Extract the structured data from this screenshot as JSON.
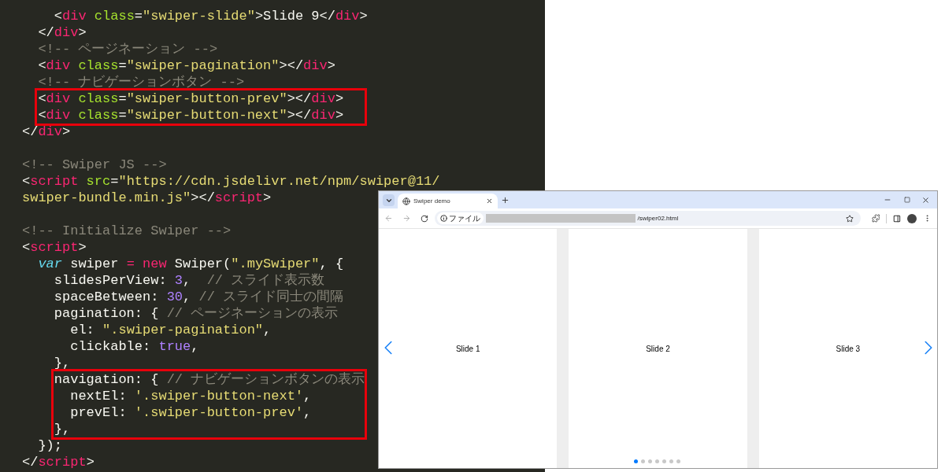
{
  "editor": {
    "blocks": [
      {
        "highlighted": false,
        "lines": [
          {
            "kind": "code",
            "tokens": [
              {
                "text": "    <",
                "kind": "punct"
              },
              {
                "text": "div",
                "kind": "tag"
              },
              {
                "text": " class",
                "kind": "attr"
              },
              {
                "text": "=",
                "kind": "punct"
              },
              {
                "text": "\"swiper-slide\"",
                "kind": "string"
              },
              {
                "text": ">Slide 9</",
                "kind": "punct"
              },
              {
                "text": "div",
                "kind": "tag"
              },
              {
                "text": ">",
                "kind": "punct"
              }
            ]
          },
          {
            "kind": "code",
            "tokens": [
              {
                "text": "  </",
                "kind": "punct"
              },
              {
                "text": "div",
                "kind": "tag"
              },
              {
                "text": ">",
                "kind": "punct"
              }
            ]
          },
          {
            "kind": "code",
            "tokens": [
              {
                "text": "  <!-- ページネーション -->",
                "kind": "comment"
              }
            ]
          },
          {
            "kind": "code",
            "tokens": [
              {
                "text": "  <",
                "kind": "punct"
              },
              {
                "text": "div",
                "kind": "tag"
              },
              {
                "text": " class",
                "kind": "attr"
              },
              {
                "text": "=",
                "kind": "punct"
              },
              {
                "text": "\"swiper-pagination\"",
                "kind": "string"
              },
              {
                "text": "></",
                "kind": "punct"
              },
              {
                "text": "div",
                "kind": "tag"
              },
              {
                "text": ">",
                "kind": "punct"
              }
            ]
          },
          {
            "kind": "code",
            "tokens": [
              {
                "text": "  <!-- ナビゲーションボタン -->",
                "kind": "comment"
              }
            ]
          }
        ]
      },
      {
        "highlighted": true,
        "lines": [
          {
            "kind": "code",
            "tokens": [
              {
                "text": "  <",
                "kind": "punct"
              },
              {
                "text": "div",
                "kind": "tag"
              },
              {
                "text": " class",
                "kind": "attr"
              },
              {
                "text": "=",
                "kind": "punct"
              },
              {
                "text": "\"swiper-button-prev\"",
                "kind": "string"
              },
              {
                "text": "></",
                "kind": "punct"
              },
              {
                "text": "div",
                "kind": "tag"
              },
              {
                "text": ">",
                "kind": "punct"
              }
            ]
          },
          {
            "kind": "code",
            "tokens": [
              {
                "text": "  <",
                "kind": "punct"
              },
              {
                "text": "div",
                "kind": "tag"
              },
              {
                "text": " class",
                "kind": "attr"
              },
              {
                "text": "=",
                "kind": "punct"
              },
              {
                "text": "\"swiper-button-next\"",
                "kind": "string"
              },
              {
                "text": "></",
                "kind": "punct"
              },
              {
                "text": "div",
                "kind": "tag"
              },
              {
                "text": ">",
                "kind": "punct"
              }
            ]
          }
        ]
      },
      {
        "highlighted": false,
        "lines": [
          {
            "kind": "code",
            "tokens": [
              {
                "text": "</",
                "kind": "punct"
              },
              {
                "text": "div",
                "kind": "tag"
              },
              {
                "text": ">",
                "kind": "punct"
              }
            ]
          },
          {
            "kind": "blank"
          },
          {
            "kind": "code",
            "tokens": [
              {
                "text": "<!-- Swiper JS -->",
                "kind": "comment"
              }
            ]
          },
          {
            "kind": "code",
            "tokens": [
              {
                "text": "<",
                "kind": "punct"
              },
              {
                "text": "script",
                "kind": "tag"
              },
              {
                "text": " src",
                "kind": "attr"
              },
              {
                "text": "=",
                "kind": "punct"
              },
              {
                "text": "\"https://cdn.jsdelivr.net/npm/swiper@11/",
                "kind": "string"
              }
            ]
          },
          {
            "kind": "code",
            "tokens": [
              {
                "text": "swiper-bundle.min.js\"",
                "kind": "string"
              },
              {
                "text": "></",
                "kind": "punct"
              },
              {
                "text": "script",
                "kind": "tag"
              },
              {
                "text": ">",
                "kind": "punct"
              }
            ]
          },
          {
            "kind": "blank"
          },
          {
            "kind": "code",
            "tokens": [
              {
                "text": "<!-- Initialize Swiper -->",
                "kind": "comment"
              }
            ]
          },
          {
            "kind": "code",
            "tokens": [
              {
                "text": "<",
                "kind": "punct"
              },
              {
                "text": "script",
                "kind": "tag"
              },
              {
                "text": ">",
                "kind": "punct"
              }
            ]
          },
          {
            "kind": "code",
            "tokens": [
              {
                "text": "  var",
                "kind": "keyword"
              },
              {
                "text": " swiper ",
                "kind": "punct"
              },
              {
                "text": "= new",
                "kind": "operator"
              },
              {
                "text": " Swiper(",
                "kind": "punct"
              },
              {
                "text": "\".mySwiper\"",
                "kind": "string"
              },
              {
                "text": ", {",
                "kind": "punct"
              }
            ]
          },
          {
            "kind": "code",
            "tokens": [
              {
                "text": "    slidesPerView: ",
                "kind": "punct"
              },
              {
                "text": "3",
                "kind": "number"
              },
              {
                "text": ",  ",
                "kind": "punct"
              },
              {
                "text": "// スライド表示数",
                "kind": "comment"
              }
            ]
          },
          {
            "kind": "code",
            "tokens": [
              {
                "text": "    spaceBetween: ",
                "kind": "punct"
              },
              {
                "text": "30",
                "kind": "number"
              },
              {
                "text": ", ",
                "kind": "punct"
              },
              {
                "text": "// スライド同士の間隔",
                "kind": "comment"
              }
            ]
          },
          {
            "kind": "code",
            "tokens": [
              {
                "text": "    pagination: { ",
                "kind": "punct"
              },
              {
                "text": "// ページネーションの表示",
                "kind": "comment"
              }
            ]
          },
          {
            "kind": "code",
            "tokens": [
              {
                "text": "      el: ",
                "kind": "punct"
              },
              {
                "text": "\".swiper-pagination\"",
                "kind": "string"
              },
              {
                "text": ",",
                "kind": "punct"
              }
            ]
          },
          {
            "kind": "code",
            "tokens": [
              {
                "text": "      clickable: ",
                "kind": "punct"
              },
              {
                "text": "true",
                "kind": "number"
              },
              {
                "text": ",",
                "kind": "punct"
              }
            ]
          },
          {
            "kind": "code",
            "tokens": [
              {
                "text": "    },",
                "kind": "punct"
              }
            ]
          }
        ]
      },
      {
        "highlighted": true,
        "lines": [
          {
            "kind": "code",
            "tokens": [
              {
                "text": "    navigation: { ",
                "kind": "punct"
              },
              {
                "text": "// ナビゲーションボタンの表示",
                "kind": "comment"
              }
            ]
          },
          {
            "kind": "code",
            "tokens": [
              {
                "text": "      nextEl: ",
                "kind": "punct"
              },
              {
                "text": "'.swiper-button-next'",
                "kind": "string"
              },
              {
                "text": ",",
                "kind": "punct"
              }
            ]
          },
          {
            "kind": "code",
            "tokens": [
              {
                "text": "      prevEl: ",
                "kind": "punct"
              },
              {
                "text": "'.swiper-button-prev'",
                "kind": "string"
              },
              {
                "text": ",",
                "kind": "punct"
              }
            ]
          },
          {
            "kind": "code",
            "tokens": [
              {
                "text": "    },",
                "kind": "punct"
              }
            ]
          }
        ]
      },
      {
        "highlighted": false,
        "lines": [
          {
            "kind": "code",
            "tokens": [
              {
                "text": "  });",
                "kind": "punct"
              }
            ]
          },
          {
            "kind": "code",
            "tokens": [
              {
                "text": "</",
                "kind": "punct"
              },
              {
                "text": "script",
                "kind": "tag"
              },
              {
                "text": ">",
                "kind": "punct"
              }
            ]
          }
        ]
      }
    ]
  },
  "browser": {
    "tab": {
      "title": "Swiper demo"
    },
    "address": {
      "chip": "ファイル",
      "path": "/swiper02.html"
    },
    "slides": [
      {
        "label": "Slide 1"
      },
      {
        "label": "Slide 2"
      },
      {
        "label": "Slide 3"
      }
    ],
    "pagination": [
      {
        "selected": true
      },
      {
        "selected": false
      },
      {
        "selected": false
      },
      {
        "selected": false
      },
      {
        "selected": false
      },
      {
        "selected": false
      },
      {
        "selected": false
      }
    ]
  }
}
